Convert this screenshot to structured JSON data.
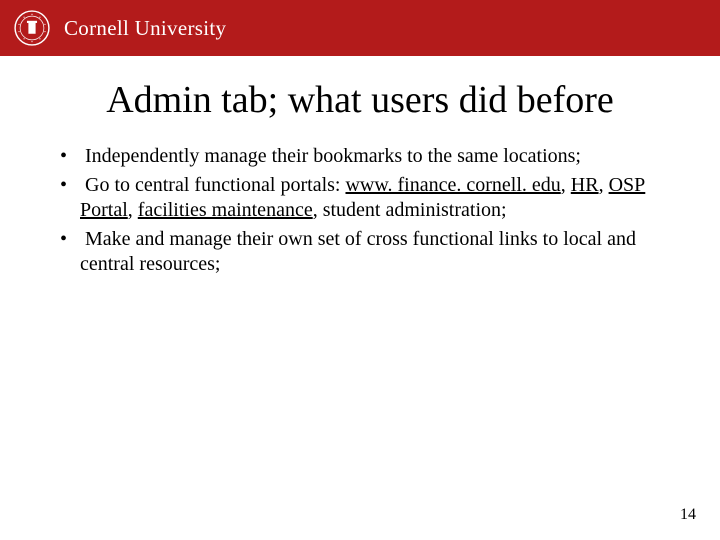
{
  "header": {
    "wordmark": "Cornell University",
    "seal_alt": "cornell-seal"
  },
  "title": "Admin tab; what users did before",
  "bullets": [
    {
      "pre": "Independently manage their bookmarks to the same locations;"
    },
    {
      "pre": "Go to central functional portals: ",
      "links": [
        "www. finance. cornell. edu",
        "HR",
        "OSP Portal",
        "facilities maintenance"
      ],
      "tail": ", student administration;"
    },
    {
      "pre": "Make and manage their own set of cross functional links to local and central resources;"
    }
  ],
  "page_number": "14"
}
